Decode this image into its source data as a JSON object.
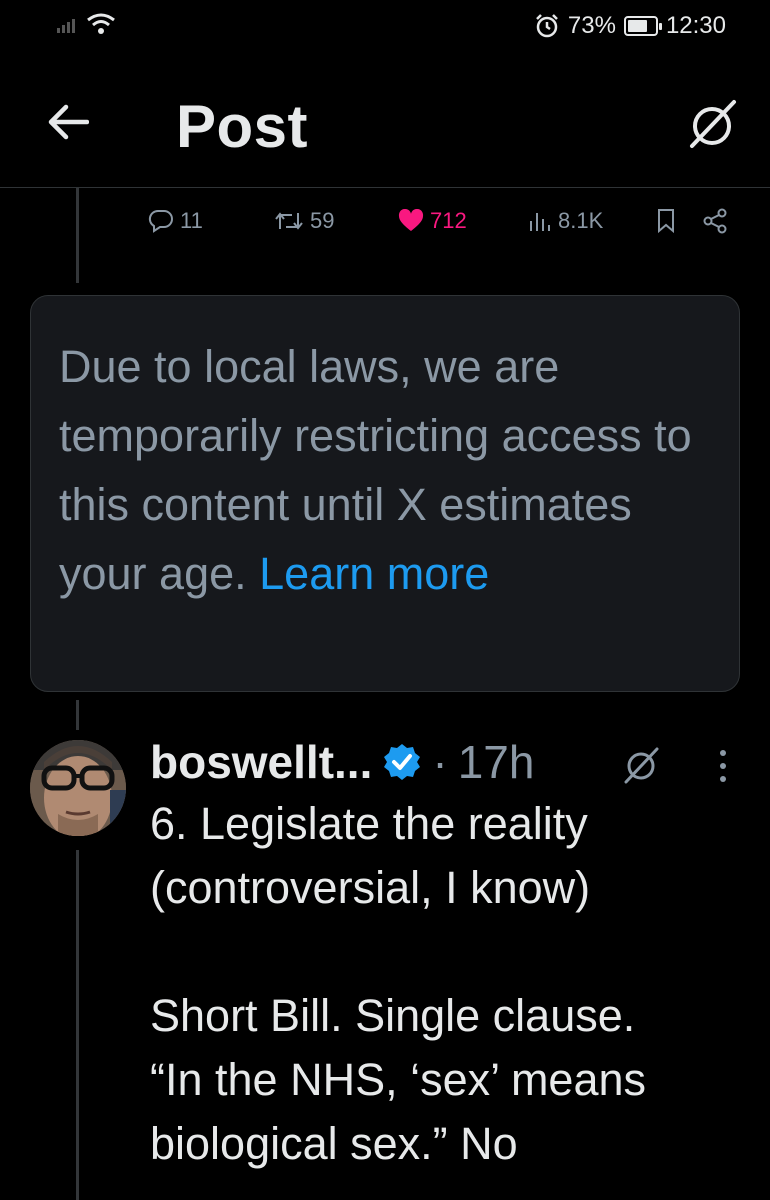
{
  "status_bar": {
    "battery_percent": "73%",
    "battery_level": 0.73,
    "time": "12:30",
    "icons": [
      "signal-icon",
      "wifi-icon",
      "alarm-icon",
      "battery-icon"
    ]
  },
  "header": {
    "title": "Post",
    "back_icon": "arrow-left-icon",
    "grok_icon": "grok-icon"
  },
  "actions": {
    "replies": "11",
    "reposts": "59",
    "likes": "712",
    "views": "8.1K",
    "icons": [
      "reply-icon",
      "repost-icon",
      "heart-icon",
      "views-icon",
      "bookmark-icon",
      "share-icon"
    ],
    "like_color": "#f91880"
  },
  "notice": {
    "text": "Due to local laws, we are temporarily restricting access to this content until X estimates your age. ",
    "link": "Learn more"
  },
  "tweet": {
    "author": "boswellt...",
    "separator": "·",
    "time": "17h",
    "body": "6. Legislate the reality\n(controversial, I know)\n\nShort Bill. Single clause.\n“In the NHS, ‘sex’ means\nbiological sex.” No",
    "icons": [
      "verified-badge-icon",
      "grok-icon",
      "more-vertical-icon"
    ]
  },
  "colors": {
    "background": "#000000",
    "text": "#e7e9ea",
    "muted": "#8b98a5",
    "link": "#1d9bf0",
    "like": "#f91880",
    "notice_bg": "#16181c"
  }
}
